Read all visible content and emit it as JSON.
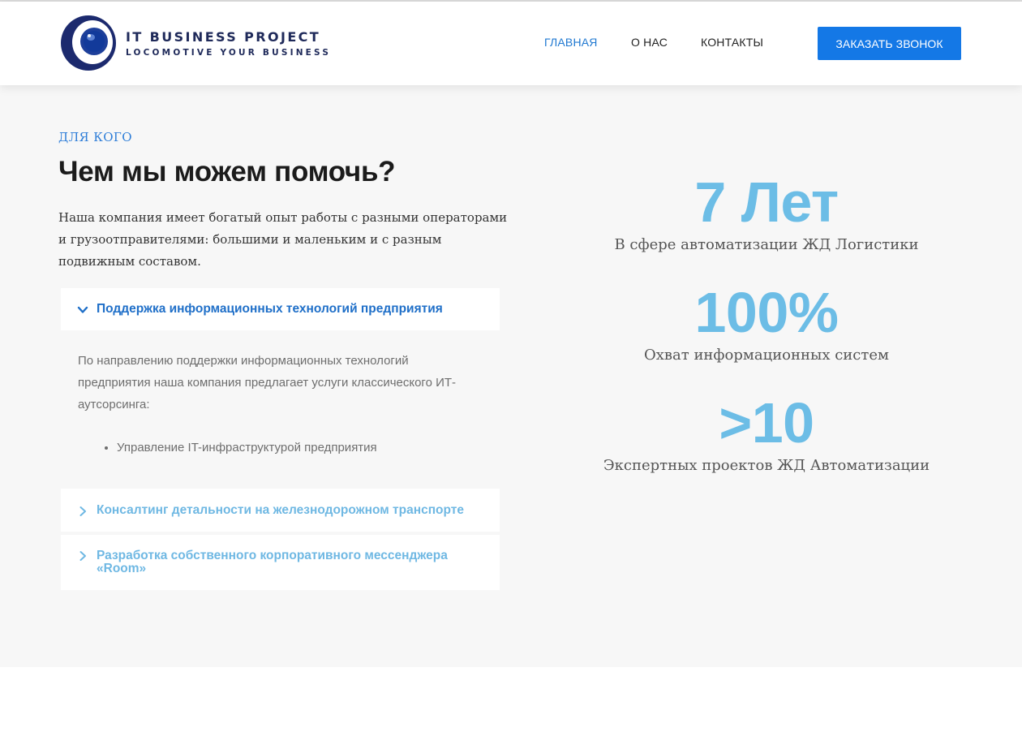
{
  "header": {
    "logo": {
      "title": "IT BUSINESS PROJECT",
      "tagline": "LOCOMOTIVE YOUR BUSINESS"
    },
    "nav": [
      {
        "label": "ГЛАВНАЯ",
        "active": true
      },
      {
        "label": "О НАС",
        "active": false
      },
      {
        "label": "КОНТАКТЫ",
        "active": false
      }
    ],
    "cta_label": "ЗАКАЗАТЬ ЗВОНОК"
  },
  "section": {
    "eyebrow": "ДЛЯ КОГО",
    "title": "Чем мы можем помочь?",
    "intro": "Наша компания имеет богатый опыт работы с разными операторами и грузоотправителями: большими и маленьким и с разным подвижным составом.",
    "accordion": [
      {
        "title": "Поддержка информационных технологий предприятия",
        "expanded": true,
        "body": "По направлению поддержки информационных технологий предприятия наша компания предлагает услуги классического ИТ-аутсорсинга:",
        "list": [
          "Управление IT-инфраструктурой предприятия"
        ]
      },
      {
        "title": "Консалтинг детальности на железнодорожном транспорте",
        "expanded": false
      },
      {
        "title": "Разработка собственного корпоративного мессенджера «Room»",
        "expanded": false
      }
    ]
  },
  "stats": [
    {
      "value": "7 Лет",
      "label": "В сфере автоматизации ЖД Логистики"
    },
    {
      "value": "100%",
      "label": "Охват информационных систем"
    },
    {
      "value": ">10",
      "label": "Экспертных проектов ЖД Автоматизации"
    }
  ],
  "colors": {
    "accent": "#1478e6",
    "nav_active": "#1f78d1",
    "accordion_active": "#1f6fc8",
    "accordion_inactive": "#6fb8e3",
    "stat_value": "#6cbde6",
    "section_bg": "#f7f7f7"
  },
  "icons": {
    "accordion_open": "chevron-down-icon",
    "accordion_closed": "chevron-right-icon"
  }
}
